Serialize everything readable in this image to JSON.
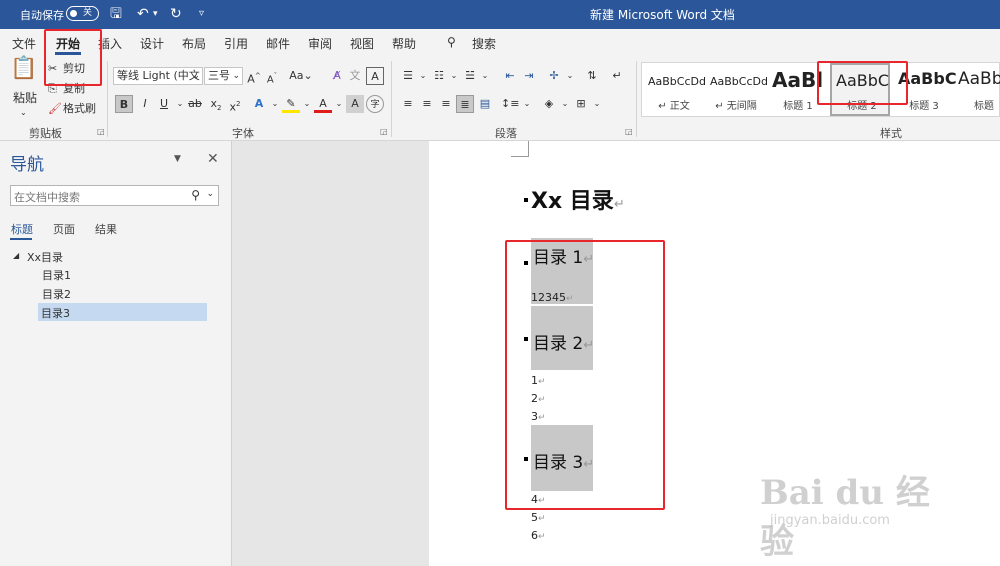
{
  "titlebar": {
    "autosave_label": "自动保存",
    "autosave_state": "关",
    "doc_title": "新建 Microsoft Word 文档"
  },
  "tabs": [
    "文件",
    "开始",
    "插入",
    "设计",
    "布局",
    "引用",
    "邮件",
    "审阅",
    "视图",
    "帮助",
    "搜索"
  ],
  "ribbon": {
    "clipboard": {
      "paste": "粘贴",
      "cut": "剪切",
      "copy": "复制",
      "format_painter": "格式刷",
      "label": "剪贴板"
    },
    "font": {
      "name": "等线 Light (中文",
      "size": "三号",
      "label": "字体",
      "case": "Aa"
    },
    "paragraph": {
      "label": "段落"
    },
    "styles": {
      "label": "样式",
      "items": [
        {
          "preview": "AaBbCcDd",
          "name": "正文"
        },
        {
          "preview": "AaBbCcDd",
          "name": "无间隔"
        },
        {
          "preview": "AaBl",
          "name": "标题 1"
        },
        {
          "preview": "AaBbC",
          "name": "标题 2"
        },
        {
          "preview": "AaBbC",
          "name": "标题 3"
        },
        {
          "preview": "AaBb",
          "name": "标题"
        }
      ]
    }
  },
  "nav": {
    "title": "导航",
    "search_placeholder": "在文档中搜索",
    "tabs": [
      "标题",
      "页面",
      "结果"
    ],
    "tree": [
      {
        "label": "Xx目录",
        "level": 0,
        "selected": false
      },
      {
        "label": "目录1",
        "level": 1,
        "selected": false
      },
      {
        "label": "目录2",
        "level": 1,
        "selected": false
      },
      {
        "label": "目录3",
        "level": 1,
        "selected": true
      }
    ]
  },
  "document": {
    "heading1": "Xx 目录",
    "sections": [
      {
        "heading": "目录 1",
        "lines": [
          "12345"
        ]
      },
      {
        "heading": "目录 2",
        "lines": [
          "1",
          "2",
          "3"
        ]
      },
      {
        "heading": "目录 3",
        "lines": [
          "4",
          "5",
          "6"
        ]
      }
    ]
  },
  "watermark": {
    "brand": "Bai du 经验",
    "url": "jingyan.baidu.com"
  }
}
